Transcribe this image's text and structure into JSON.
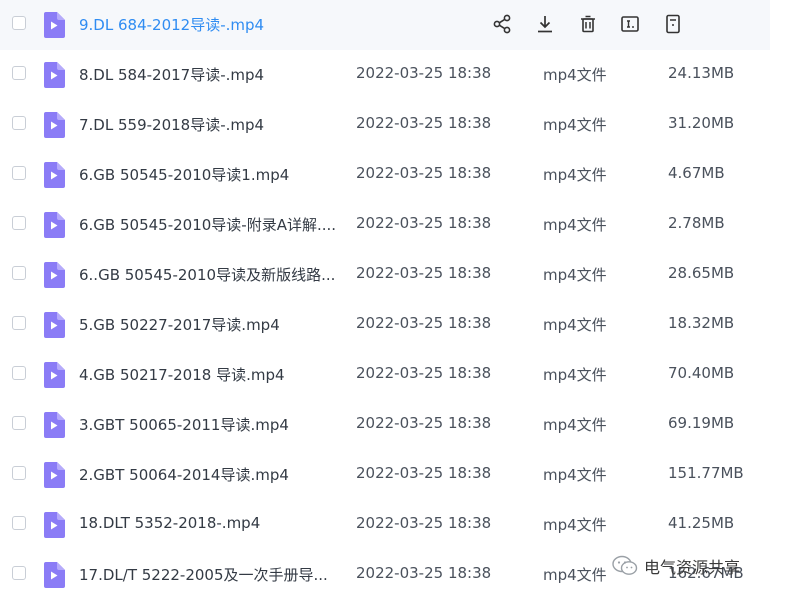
{
  "files": [
    {
      "name": "9.DL 684-2012导读-.mp4",
      "date": "",
      "type": "",
      "size": "",
      "hover": true
    },
    {
      "name": "8.DL 584-2017导读-.mp4",
      "date": "2022-03-25 18:38",
      "type": "mp4文件",
      "size": "24.13MB"
    },
    {
      "name": "7.DL 559-2018导读-.mp4",
      "date": "2022-03-25 18:38",
      "type": "mp4文件",
      "size": "31.20MB"
    },
    {
      "name": "6.GB 50545-2010导读1.mp4",
      "date": "2022-03-25 18:38",
      "type": "mp4文件",
      "size": "4.67MB"
    },
    {
      "name": "6.GB 50545-2010导读-附录A详解....",
      "date": "2022-03-25 18:38",
      "type": "mp4文件",
      "size": "2.78MB"
    },
    {
      "name": "6..GB 50545-2010导读及新版线路...",
      "date": "2022-03-25 18:38",
      "type": "mp4文件",
      "size": "28.65MB"
    },
    {
      "name": "5.GB 50227-2017导读.mp4",
      "date": "2022-03-25 18:38",
      "type": "mp4文件",
      "size": "18.32MB"
    },
    {
      "name": "4.GB 50217-2018 导读.mp4",
      "date": "2022-03-25 18:38",
      "type": "mp4文件",
      "size": "70.40MB"
    },
    {
      "name": "3.GBT 50065-2011导读.mp4",
      "date": "2022-03-25 18:38",
      "type": "mp4文件",
      "size": "69.19MB"
    },
    {
      "name": "2.GBT 50064-2014导读.mp4",
      "date": "2022-03-25 18:38",
      "type": "mp4文件",
      "size": "151.77MB"
    },
    {
      "name": "18.DLT 5352-2018-.mp4",
      "date": "2022-03-25 18:38",
      "type": "mp4文件",
      "size": "41.25MB"
    },
    {
      "name": "17.DL/T  5222-2005及一次手册导...",
      "date": "2022-03-25 18:38",
      "type": "mp4文件",
      "size": "162.67MB"
    }
  ],
  "hover_actions": [
    "share-icon",
    "download-icon",
    "delete-icon",
    "rename-icon",
    "more-icon"
  ],
  "icons": {
    "file": "video-file-icon"
  },
  "colors": {
    "accent": "#2f8cf2",
    "file_icon": "#8b7cf6",
    "hover_bg": "#f6f8fb"
  },
  "watermark": {
    "text": "电气资源共享"
  }
}
